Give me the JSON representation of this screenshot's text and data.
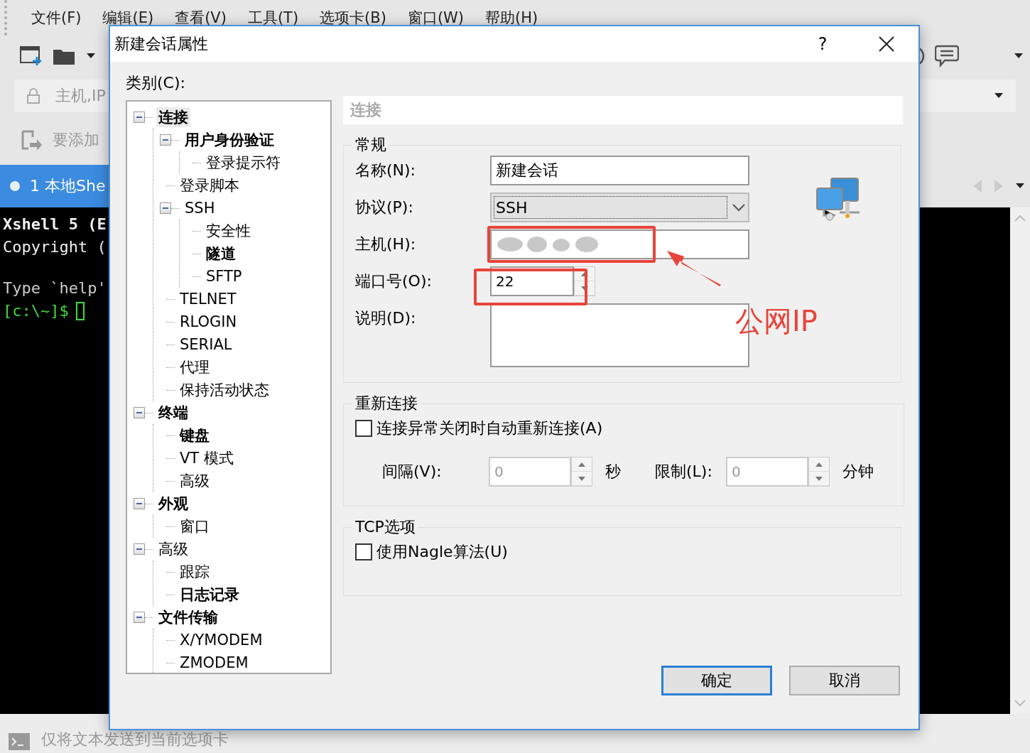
{
  "app": {
    "menu": [
      "文件(F)",
      "编辑(E)",
      "查看(V)",
      "工具(T)",
      "选项卡(B)",
      "窗口(W)",
      "帮助(H)"
    ],
    "address": {
      "placeholder": "主机,IP"
    },
    "hint": "要添加",
    "tab": {
      "label": "1 本地She",
      "selected": true
    },
    "terminal": {
      "lines": [
        {
          "kind": "header",
          "text": "Xshell 5 (E"
        },
        {
          "kind": "header",
          "text": "Copyright ("
        },
        {
          "kind": "info",
          "text": "Type `help'"
        }
      ],
      "prompt": "[c:\\~]$"
    },
    "send_bar": "仅将文本发送到当前选项卡"
  },
  "dialog": {
    "title": "新建会话属性",
    "help": "?",
    "category_label": "类别(C):",
    "tree": [
      {
        "label": "连接",
        "bold": true,
        "selected": true,
        "expanded": true,
        "children": [
          {
            "label": "用户身份验证",
            "bold": true,
            "selected": false,
            "expanded": true,
            "children": [
              {
                "label": "登录提示符",
                "bold": false,
                "selected": false
              }
            ]
          },
          {
            "label": "登录脚本",
            "bold": false,
            "selected": false
          },
          {
            "label": "SSH",
            "bold": false,
            "selected": false,
            "expanded": true,
            "children": [
              {
                "label": "安全性",
                "bold": false,
                "selected": false
              },
              {
                "label": "隧道",
                "bold": true,
                "selected": false
              },
              {
                "label": "SFTP",
                "bold": false,
                "selected": false
              }
            ]
          },
          {
            "label": "TELNET",
            "bold": false,
            "selected": false
          },
          {
            "label": "RLOGIN",
            "bold": false,
            "selected": false
          },
          {
            "label": "SERIAL",
            "bold": false,
            "selected": false
          },
          {
            "label": "代理",
            "bold": false,
            "selected": false
          },
          {
            "label": "保持活动状态",
            "bold": false,
            "selected": false
          }
        ]
      },
      {
        "label": "终端",
        "bold": true,
        "selected": false,
        "expanded": true,
        "children": [
          {
            "label": "键盘",
            "bold": true,
            "selected": false
          },
          {
            "label": "VT 模式",
            "bold": false,
            "selected": false
          },
          {
            "label": "高级",
            "bold": false,
            "selected": false
          }
        ]
      },
      {
        "label": "外观",
        "bold": true,
        "selected": false,
        "expanded": true,
        "children": [
          {
            "label": "窗口",
            "bold": false,
            "selected": false
          }
        ]
      },
      {
        "label": "高级",
        "bold": false,
        "selected": false,
        "expanded": true,
        "children": [
          {
            "label": "跟踪",
            "bold": false,
            "selected": false
          },
          {
            "label": "日志记录",
            "bold": true,
            "selected": false
          }
        ]
      },
      {
        "label": "文件传输",
        "bold": true,
        "selected": false,
        "expanded": true,
        "children": [
          {
            "label": "X/YMODEM",
            "bold": false,
            "selected": false
          },
          {
            "label": "ZMODEM",
            "bold": false,
            "selected": false
          }
        ]
      }
    ],
    "section_title": "连接",
    "general": {
      "legend": "常规",
      "fields": [
        {
          "kind": "text",
          "label": "名称(N):",
          "value": "新建会话"
        },
        {
          "kind": "select",
          "label": "协议(P):",
          "value": "SSH"
        },
        {
          "kind": "redacted",
          "label": "主机(H):"
        },
        {
          "kind": "spin",
          "label": "端口号(O):",
          "value": "22"
        },
        {
          "kind": "textarea",
          "label": "说明(D):"
        }
      ]
    },
    "reconnect": {
      "legend": "重新连接",
      "checkbox": {
        "label": "连接异常关闭时自动重新连接(A)",
        "checked": false
      },
      "spinners": [
        {
          "label": "间隔(V):",
          "value": "0",
          "unit": "秒",
          "disabled": true
        },
        {
          "label": "限制(L):",
          "value": "0",
          "unit": "分钟",
          "disabled": true
        }
      ]
    },
    "tcp": {
      "legend": "TCP选项",
      "checkbox": {
        "label": "使用Nagle算法(U)",
        "checked": false
      }
    },
    "buttons": [
      {
        "label": "确定",
        "default": true
      },
      {
        "label": "取消",
        "default": false
      }
    ]
  },
  "annotation": {
    "label": "公网IP"
  }
}
